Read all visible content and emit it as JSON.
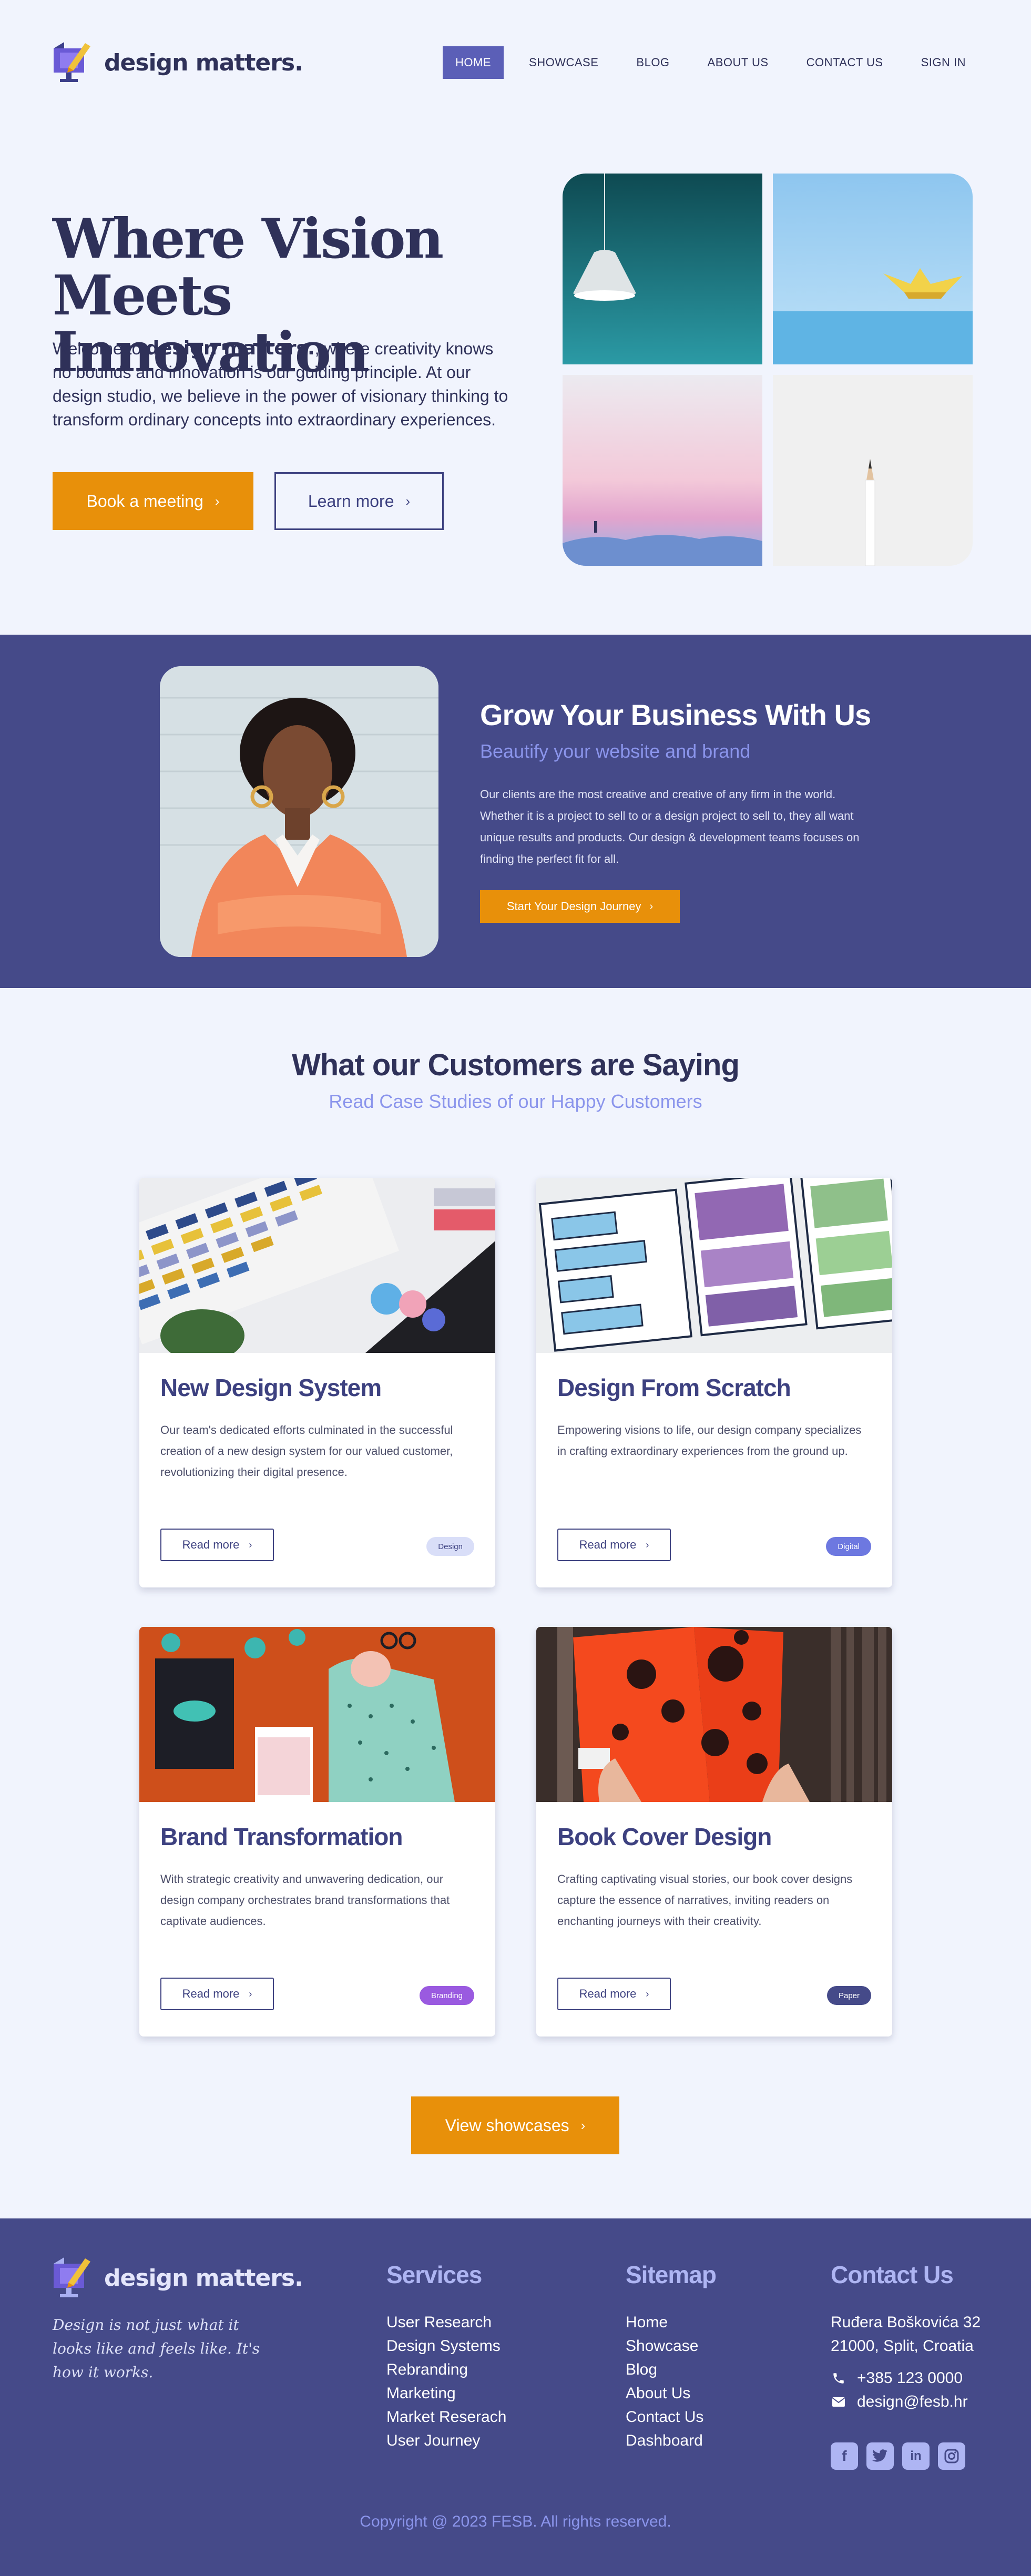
{
  "brand": {
    "name": "design matters."
  },
  "nav": {
    "items": [
      {
        "label": "HOME",
        "active": true
      },
      {
        "label": "SHOWCASE"
      },
      {
        "label": "BLOG"
      },
      {
        "label": "ABOUT US"
      },
      {
        "label": "CONTACT US"
      },
      {
        "label": "SIGN IN"
      }
    ]
  },
  "hero": {
    "title": "Where Vision Meets Innovation",
    "text_before": "Welcome to ",
    "text_brand": "design matters.",
    "text_after": ", where creativity knows no bounds and innovation is our guiding principle. At our design studio, we believe in the power of visionary thinking to transform ordinary concepts into extraordinary experiences.",
    "primary_button": "Book a meeting",
    "secondary_button": "Learn more"
  },
  "grow": {
    "title": "Grow Your Business With Us",
    "subtitle": "Beautify your website and brand",
    "text": "Our clients are the most creative and creative of any firm in the world. Whether it is a project to sell to or a design project to sell to, they all want unique results and products. Our design & development teams focuses on finding the perfect fit for all.",
    "button": "Start Your Design Journey"
  },
  "testimonials": {
    "title": "What our Customers are Saying",
    "subtitle": "Read Case Studies of our Happy Customers",
    "cards": [
      {
        "title": "New Design System",
        "text": "Our team's dedicated efforts culminated in the successful creation of a new design system for our valued customer, revolutionizing their digital presence.",
        "button": "Read more",
        "tag": "Design"
      },
      {
        "title": "Design From Scratch",
        "text": "Empowering visions to life, our design company specializes in crafting extraordinary experiences from the ground up.",
        "button": "Read more",
        "tag": "Digital"
      },
      {
        "title": "Brand Transformation",
        "text": "With strategic creativity and unwavering dedication, our design company orchestrates brand transformations that captivate audiences.",
        "button": "Read more",
        "tag": "Branding"
      },
      {
        "title": "Book Cover Design",
        "text": "Crafting captivating visual stories, our book cover designs capture the essence of narratives, inviting readers on enchanting journeys with their creativity.",
        "button": "Read more",
        "tag": "Paper"
      }
    ],
    "showcase_button": "View showcases"
  },
  "footer": {
    "tagline": "Design is not just what it looks like and feels like. It's how it works.",
    "services": {
      "title": "Services",
      "items": [
        "User Research",
        "Design Systems",
        "Rebranding",
        "Marketing",
        "Market Reserach",
        "User Journey"
      ]
    },
    "sitemap": {
      "title": "Sitemap",
      "items": [
        "Home",
        "Showcase",
        "Blog",
        "About Us",
        "Contact Us",
        "Dashboard"
      ]
    },
    "contact": {
      "title": "Contact Us",
      "address_line1": "Ruđera Boškovića 32",
      "address_line2": "21000, Split, Croatia",
      "phone": "+385 123 0000",
      "email": "design@fesb.hr"
    },
    "socials": [
      "facebook-icon",
      "twitter-icon",
      "linkedin-icon",
      "instagram-icon"
    ],
    "copyright": "Copyright @ 2023 FESB. All rights reserved."
  },
  "colors": {
    "primary": "#454a89",
    "accent": "#e8900a",
    "background": "#f1f4fd",
    "heading": "#2f3159",
    "lavender": "#8b95ec"
  }
}
